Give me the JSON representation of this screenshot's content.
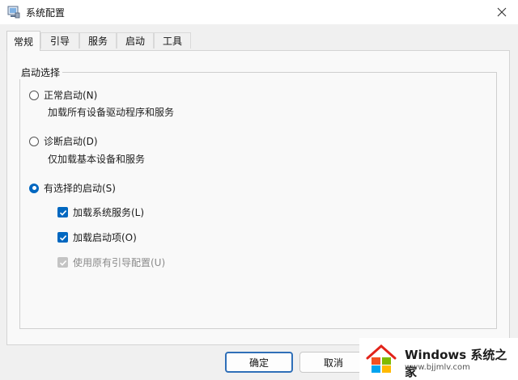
{
  "window": {
    "title": "系统配置",
    "close_icon": "close-icon"
  },
  "tabs": [
    {
      "label": "常规",
      "active": true
    },
    {
      "label": "引导",
      "active": false
    },
    {
      "label": "服务",
      "active": false
    },
    {
      "label": "启动",
      "active": false
    },
    {
      "label": "工具",
      "active": false
    }
  ],
  "startup_selection": {
    "legend": "启动选择",
    "normal": {
      "label": "正常启动(N)",
      "desc": "加载所有设备驱动程序和服务",
      "checked": false
    },
    "diagnostic": {
      "label": "诊断启动(D)",
      "desc": "仅加载基本设备和服务",
      "checked": false
    },
    "selective": {
      "label": "有选择的启动(S)",
      "checked": true
    },
    "options": [
      {
        "label": "加载系统服务(L)",
        "checked": true,
        "enabled": true
      },
      {
        "label": "加载启动项(O)",
        "checked": true,
        "enabled": true
      },
      {
        "label": "使用原有引导配置(U)",
        "checked": true,
        "enabled": false
      }
    ]
  },
  "buttons": {
    "ok": "确定",
    "cancel": "取消"
  },
  "watermark": {
    "title": "Windows 系统之家",
    "url": "www.bjjmlv.com"
  },
  "colors": {
    "accent": "#0067c0",
    "disabled": "#c4c4c4"
  }
}
